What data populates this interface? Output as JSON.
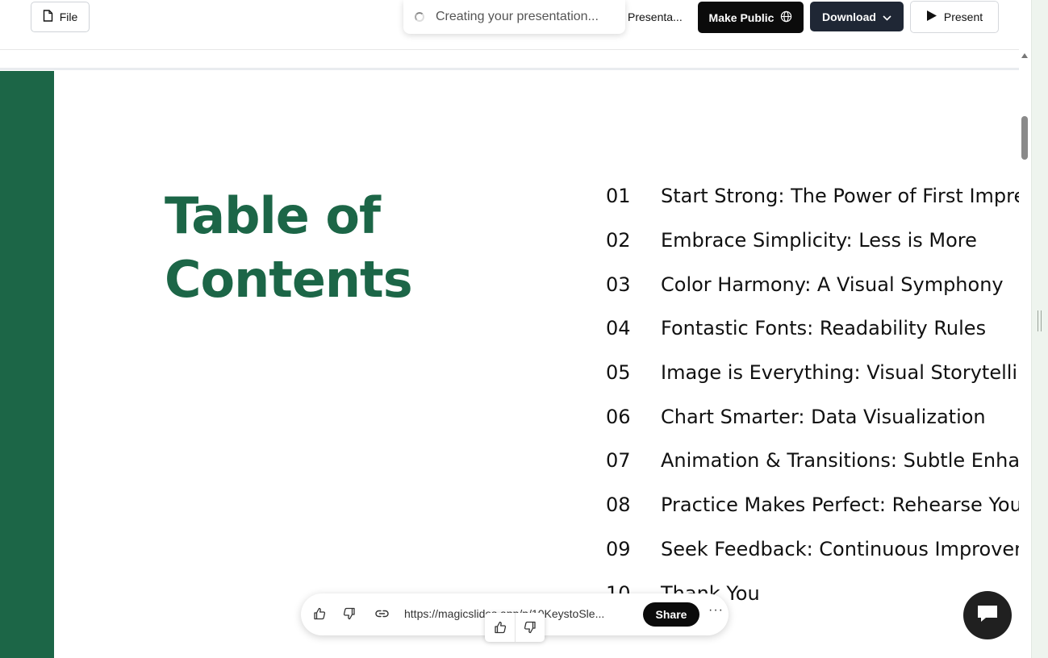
{
  "topbar": {
    "file_label": "File",
    "toast_text": "Creating your presentation...",
    "presentation_label": "Presenta...",
    "make_public_label": "Make Public",
    "download_label": "Download",
    "present_label": "Present"
  },
  "slide": {
    "title_line1": "Table of",
    "title_line2": "Contents",
    "accent_color": "#1c6647",
    "items": [
      {
        "num": "01",
        "text": "Start Strong: The Power of First Impressions"
      },
      {
        "num": "02",
        "text": "Embrace Simplicity: Less is More"
      },
      {
        "num": "03",
        "text": "Color Harmony: A Visual Symphony"
      },
      {
        "num": "04",
        "text": "Fontastic Fonts: Readability Rules"
      },
      {
        "num": "05",
        "text": "Image is Everything: Visual Storytelling"
      },
      {
        "num": "06",
        "text": "Chart Smarter: Data Visualization"
      },
      {
        "num": "07",
        "text": "Animation & Transitions: Subtle Enhancements"
      },
      {
        "num": "08",
        "text": "Practice Makes Perfect: Rehearse Your Delivery"
      },
      {
        "num": "09",
        "text": "Seek Feedback: Continuous Improvement"
      },
      {
        "num": "10",
        "text": "Thank You"
      }
    ]
  },
  "share_bar": {
    "url": "https://magicslides.app/p/10KeystoSle...",
    "share_label": "Share",
    "more_label": "···"
  },
  "icons": {
    "file": "file-icon",
    "globe": "globe-icon",
    "chevron": "chevron-down-icon",
    "play": "play-icon",
    "thumbs_up": "thumbs-up-icon",
    "thumbs_down": "thumbs-down-icon",
    "link": "link-icon",
    "chat": "chat-icon"
  }
}
